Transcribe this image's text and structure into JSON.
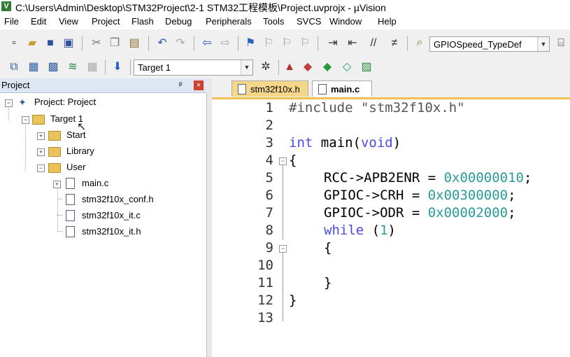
{
  "window": {
    "title": "C:\\Users\\Admin\\Desktop\\STM32Project\\2-1 STM32工程模板\\Project.uvprojx - µVision"
  },
  "menu": [
    "File",
    "Edit",
    "View",
    "Project",
    "Flash",
    "Debug",
    "Peripherals",
    "Tools",
    "SVCS",
    "Window",
    "Help"
  ],
  "toolbar": {
    "find_combo_value": "GPIOSpeed_TypeDef",
    "target_combo_value": "Target 1"
  },
  "project_panel": {
    "title": "Project",
    "pin_glyph": "ᵖ",
    "close_glyph": "×",
    "tree": {
      "root": "Project: Project",
      "target": "Target 1",
      "groups": [
        "Start",
        "Library",
        "User"
      ],
      "user_files": [
        "main.c",
        "stm32f10x_conf.h",
        "stm32f10x_it.c",
        "stm32f10x_it.h"
      ]
    }
  },
  "editor": {
    "tabs": [
      "stm32f10x.h",
      "main.c"
    ],
    "active_tab": "main.c",
    "line_numbers": [
      "1",
      "2",
      "3",
      "4",
      "5",
      "6",
      "7",
      "8",
      "9",
      "10",
      "11",
      "12",
      "13"
    ],
    "lines": {
      "l1_directive": "#include",
      "l1_string": "\"stm32f10x.h\"",
      "l3_type": "int",
      "l3_name": "main(",
      "l3_param": "void",
      "l3_close": ")",
      "l4": "{",
      "l5_left": "RCC->APB2ENR = ",
      "l5_value": "0x00000010",
      "l5_end": ";",
      "l6_left": "GPIOC->CRH = ",
      "l6_value": "0x00300000",
      "l6_end": ";",
      "l7_left": "GPIOC->ODR = ",
      "l7_value": "0x00002000",
      "l7_end": ";",
      "l8_kw": "while",
      "l8_open": " (",
      "l8_num": "1",
      "l8_close": ")",
      "l9": "{",
      "l11": "}",
      "l12": "}"
    }
  },
  "colors": {
    "keyword": "#4a4ae0",
    "number": "#2a9a9a",
    "tab_inactive": "#f5d78a",
    "panel_header": "#dde6f2"
  }
}
